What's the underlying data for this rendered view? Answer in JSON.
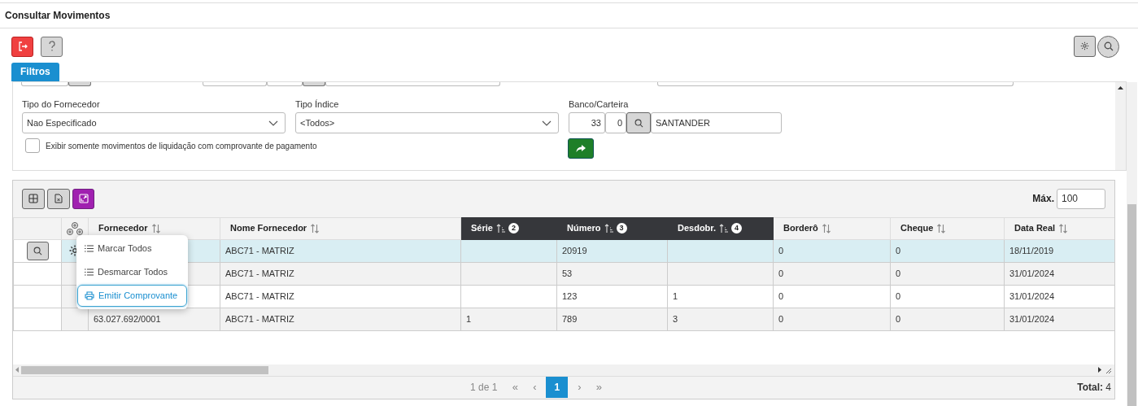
{
  "window": {
    "title": "Consultar Movimentos"
  },
  "filters_tab": {
    "label": "Filtros",
    "selected": true
  },
  "filters": {
    "fields": [
      {
        "kind": "select",
        "label": "Tipo do Fornecedor",
        "value": "Nao Especificado"
      },
      {
        "kind": "select",
        "label": "Tipo Índice",
        "value": "<Todos>"
      },
      {
        "kind": "lookup",
        "label": "Banco/Carteira",
        "code": "33",
        "sub_code": "0",
        "value": "SANTANDER"
      }
    ],
    "checkbox": {
      "label": "Exibir somente movimentos de liquidação com comprovante de pagamento",
      "checked": false
    }
  },
  "grid": {
    "max_label": "Máx.",
    "max_value": "100",
    "columns": [
      {
        "label": "Fornecedor",
        "sorted": false
      },
      {
        "label": "Nome Fornecedor",
        "sorted": false
      },
      {
        "label": "Série",
        "sorted": true,
        "order": "2"
      },
      {
        "label": "Número",
        "sorted": true,
        "order": "3"
      },
      {
        "label": "Desdobr.",
        "sorted": true,
        "order": "4"
      },
      {
        "label": "Borderô",
        "sorted": false
      },
      {
        "label": "Cheque",
        "sorted": false
      },
      {
        "label": "Data Real",
        "sorted": false
      }
    ],
    "rows": [
      {
        "selected": true,
        "actions": true,
        "cells": [
          null,
          "ABC71 - MATRIZ",
          null,
          "20919",
          null,
          "0",
          "0",
          "18/11/2019"
        ]
      },
      {
        "selected": false,
        "actions": false,
        "cells": [
          null,
          "ABC71 - MATRIZ",
          null,
          "53",
          null,
          "0",
          "0",
          "31/01/2024"
        ]
      },
      {
        "selected": false,
        "actions": false,
        "cells": [
          null,
          "ABC71 - MATRIZ",
          null,
          "123",
          "1",
          "0",
          "0",
          "31/01/2024"
        ]
      },
      {
        "selected": false,
        "actions": false,
        "cells": [
          "63.027.692/0001",
          "ABC71 - MATRIZ",
          "1",
          "789",
          "3",
          "0",
          "0",
          "31/01/2024"
        ]
      }
    ],
    "context_menu": [
      {
        "label": "Marcar Todos",
        "kind": "list",
        "selected": false
      },
      {
        "label": "Desmarcar Todos",
        "kind": "list",
        "selected": false
      },
      {
        "label": "Emitir Comprovante",
        "kind": "print",
        "selected": true
      }
    ],
    "pager": {
      "info": "1 de 1",
      "first": "«",
      "prev": "‹",
      "pages": [
        {
          "label": "1",
          "selected": true
        }
      ],
      "next": "›",
      "last": "»"
    },
    "total": "**Total:** 4"
  }
}
